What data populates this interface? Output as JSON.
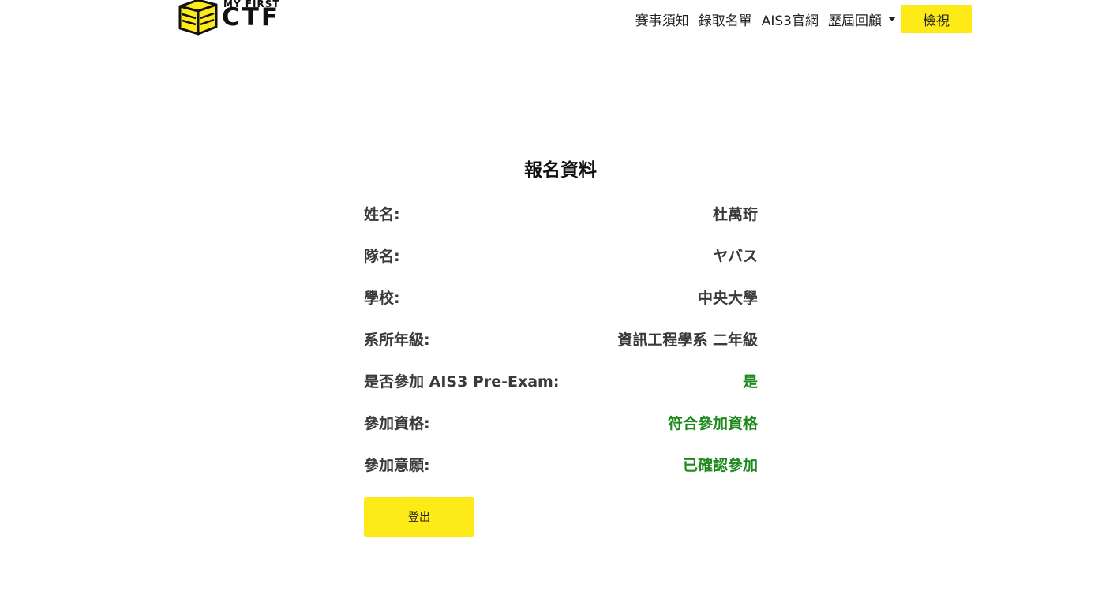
{
  "header": {
    "logo": {
      "small_text": "MY FIRST",
      "big_text": "CTF",
      "colors": {
        "yellow": "#fdea17",
        "outline": "#111111"
      }
    },
    "nav": [
      {
        "label": "賽事須知"
      },
      {
        "label": "錄取名單"
      },
      {
        "label": "AIS3官網"
      },
      {
        "label": "歷屆回顧"
      }
    ],
    "view_button": "檢視"
  },
  "main": {
    "title": "報名資料",
    "rows": [
      {
        "label": "姓名:",
        "value": "杜萬珩"
      },
      {
        "label": "隊名:",
        "value": "ヤバス"
      },
      {
        "label": "學校:",
        "value": "中央大學"
      },
      {
        "label": "系所年級:",
        "value": "資訊工程學系 二年級"
      },
      {
        "label": "是否參加 AIS3 Pre-Exam:",
        "value": "是"
      },
      {
        "label": "參加資格:",
        "value": "符合參加資格"
      },
      {
        "label": "參加意願:",
        "value": "已確認參加"
      }
    ],
    "logout_label": "登出"
  },
  "colors": {
    "accent": "#fdea17",
    "status_green": "#1e8a1e",
    "text": "#3a3a3a"
  }
}
